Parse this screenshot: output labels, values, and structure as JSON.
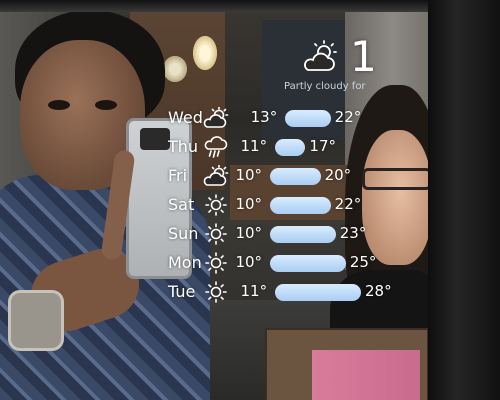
{
  "current": {
    "temperature": "1",
    "summary": "Partly cloudy for",
    "icon": "partly-cloudy-day-icon"
  },
  "forecast": [
    {
      "day": "Wed",
      "icon": "partly-cloudy-day-icon",
      "low": "13°",
      "high": "22°",
      "low_value": 13,
      "high_value": 22
    },
    {
      "day": "Thu",
      "icon": "rain-icon",
      "low": "11°",
      "high": "17°",
      "low_value": 11,
      "high_value": 17
    },
    {
      "day": "Fri",
      "icon": "partly-cloudy-day-icon",
      "low": "10°",
      "high": "20°",
      "low_value": 10,
      "high_value": 20
    },
    {
      "day": "Sat",
      "icon": "sun-icon",
      "low": "10°",
      "high": "22°",
      "low_value": 10,
      "high_value": 22
    },
    {
      "day": "Sun",
      "icon": "sun-icon",
      "low": "10°",
      "high": "23°",
      "low_value": 10,
      "high_value": 23
    },
    {
      "day": "Mon",
      "icon": "sun-icon",
      "low": "10°",
      "high": "25°",
      "low_value": 10,
      "high_value": 25
    },
    {
      "day": "Tue",
      "icon": "sun-icon",
      "low": "11°",
      "high": "28°",
      "low_value": 11,
      "high_value": 28
    }
  ],
  "colors": {
    "text": "#ffffff",
    "bar": "#c4e0fb",
    "summary": "#c9d4e2"
  }
}
